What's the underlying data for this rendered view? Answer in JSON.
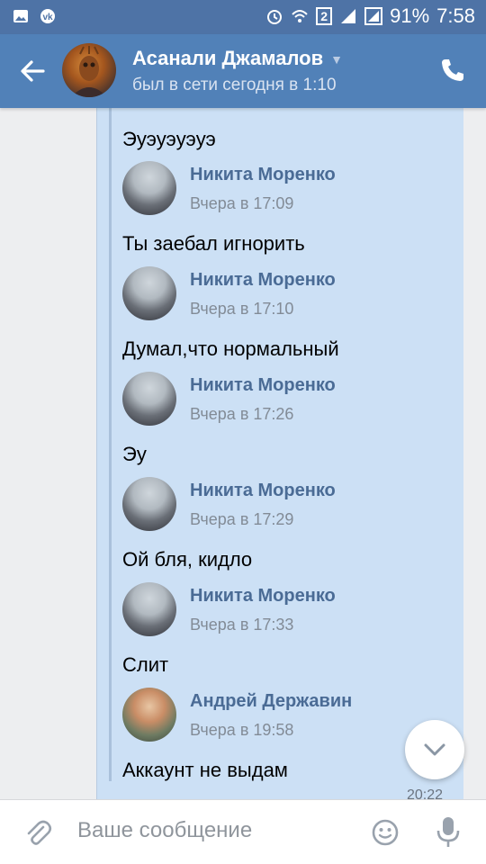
{
  "status_bar": {
    "battery_percent": "91%",
    "time": "7:58",
    "sim_badge": "2"
  },
  "header": {
    "name": "Асанали Джамалов",
    "status": "был в сети сегодня в 1:10"
  },
  "messages": [
    {
      "text": "Эуэуэуэуэ"
    },
    {
      "author": "Никита Моренко",
      "time": "Вчера в 17:09",
      "text": "Ты заебал игнорить"
    },
    {
      "author": "Никита Моренко",
      "time": "Вчера в 17:10",
      "text": "Думал,что нормальный"
    },
    {
      "author": "Никита Моренко",
      "time": "Вчера в 17:26",
      "text": "Эу"
    },
    {
      "author": "Никита Моренко",
      "time": "Вчера в 17:29",
      "text": "Ой бля, кидло"
    },
    {
      "author": "Никита Моренко",
      "time": "Вчера в 17:33",
      "text": "Слит"
    },
    {
      "author": "Андрей Державин",
      "time": "Вчера в 19:58",
      "text": "Аккаунт не выдам"
    }
  ],
  "bubble_time": "20:22",
  "composer": {
    "placeholder": "Ваше сообщение"
  },
  "colors": {
    "header": "#5181b8",
    "status_bar": "#4e73a6",
    "bubble": "#cce0f5",
    "author": "#4a6b95"
  },
  "icons": [
    "image-icon",
    "vk-icon",
    "alarm-icon",
    "wifi-icon",
    "signal-icon",
    "back-arrow-icon",
    "phone-icon",
    "chevron-down-icon",
    "attach-icon",
    "smile-icon",
    "mic-icon"
  ]
}
